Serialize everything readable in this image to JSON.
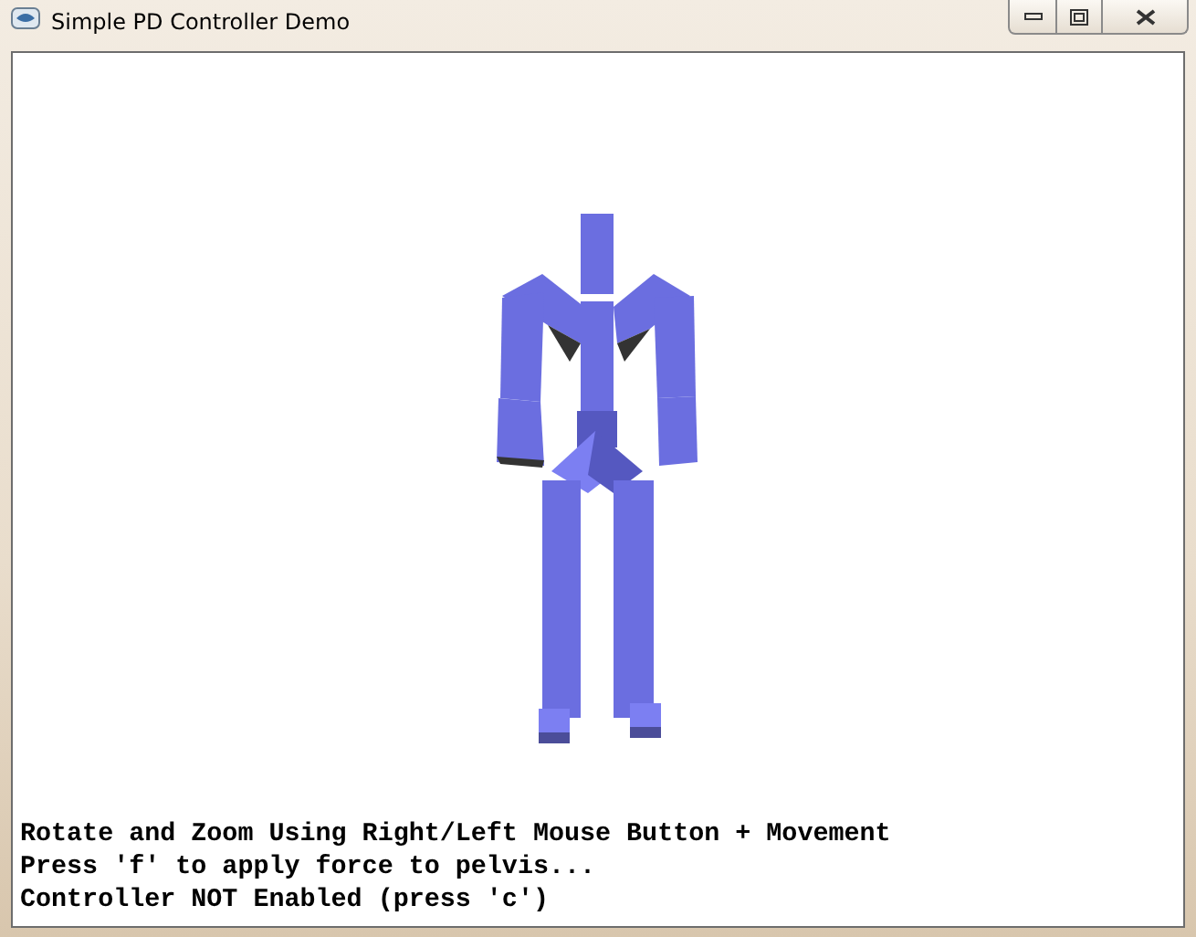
{
  "window": {
    "title": "Simple PD Controller Demo"
  },
  "console_lines": [
    "Rotate and Zoom Using Right/Left Mouse Button + Movement",
    "Press 'f' to apply force to pelvis...",
    "Controller NOT Enabled (press 'c')"
  ]
}
